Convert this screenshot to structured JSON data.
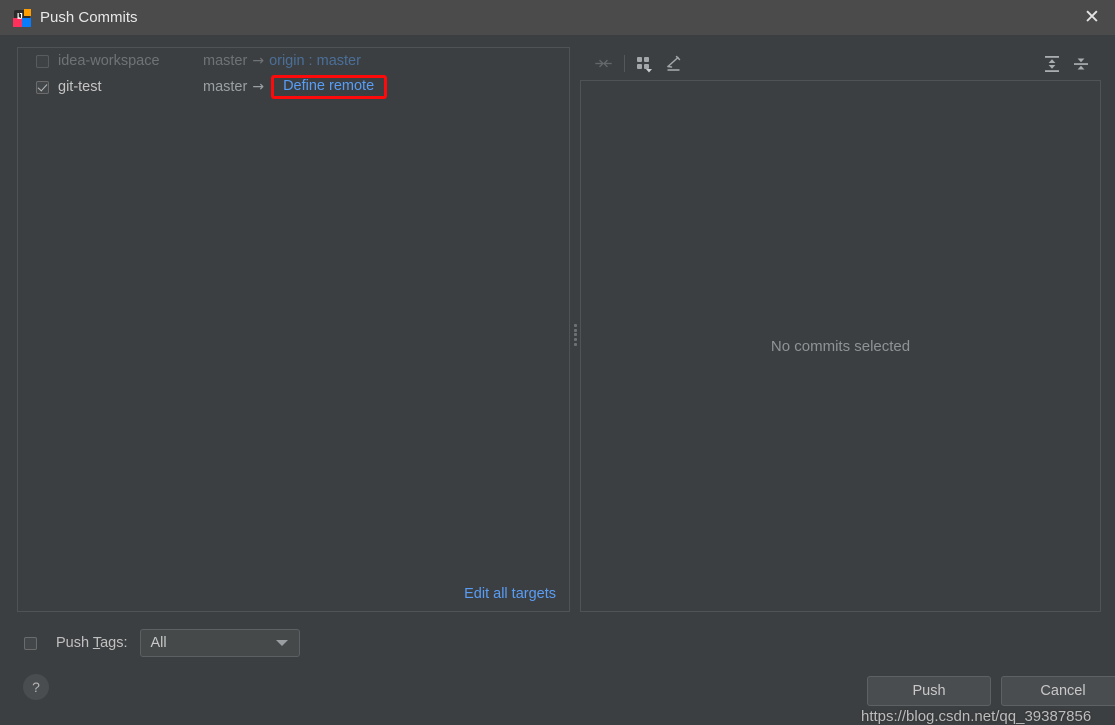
{
  "window": {
    "title": "Push Commits",
    "app_icon": "intellij-idea-icon",
    "icon_letters": "IJ",
    "close_label": "✕"
  },
  "left_panel": {
    "repositories": [
      {
        "checked": false,
        "enabled": false,
        "name": "idea-workspace",
        "local_branch": "master",
        "arrow": "→",
        "remote_target": "origin : master",
        "highlighted": false
      },
      {
        "checked": true,
        "enabled": true,
        "name": "git-test",
        "local_branch": "master",
        "arrow": "→",
        "remote_target": "Define remote",
        "highlighted": true
      }
    ],
    "edit_all_targets_label": "Edit all targets"
  },
  "toolbar": {
    "left_buttons": [
      {
        "icon": "collapse-selection-icon",
        "enabled": false
      },
      {
        "icon": "group-by-icon",
        "enabled": true,
        "has_dropdown": true
      },
      {
        "icon": "highlight-pencil-icon",
        "enabled": true
      }
    ],
    "right_buttons": [
      {
        "icon": "expand-all-icon",
        "enabled": true
      },
      {
        "icon": "collapse-all-icon",
        "enabled": true
      }
    ]
  },
  "commit_details": {
    "empty_message": "No commits selected"
  },
  "bottom": {
    "push_tags_checked": false,
    "push_tags_label_prefix": "Push ",
    "push_tags_mnemonic": "T",
    "push_tags_label_suffix": "ags:",
    "tags_dropdown_value": "All",
    "help_label": "?",
    "push_button_label": "Push",
    "cancel_button_label": "Cancel"
  },
  "overlay": {
    "watermark": "https://blog.csdn.net/qq_39387856"
  },
  "colors": {
    "window_background": "#3c3f41",
    "titlebar_background": "#4b4b4b",
    "link_blue": "#589df6",
    "highlight_red": "#ff0a0a",
    "text_primary": "#c4c4c4",
    "text_disabled": "#6f7376"
  }
}
